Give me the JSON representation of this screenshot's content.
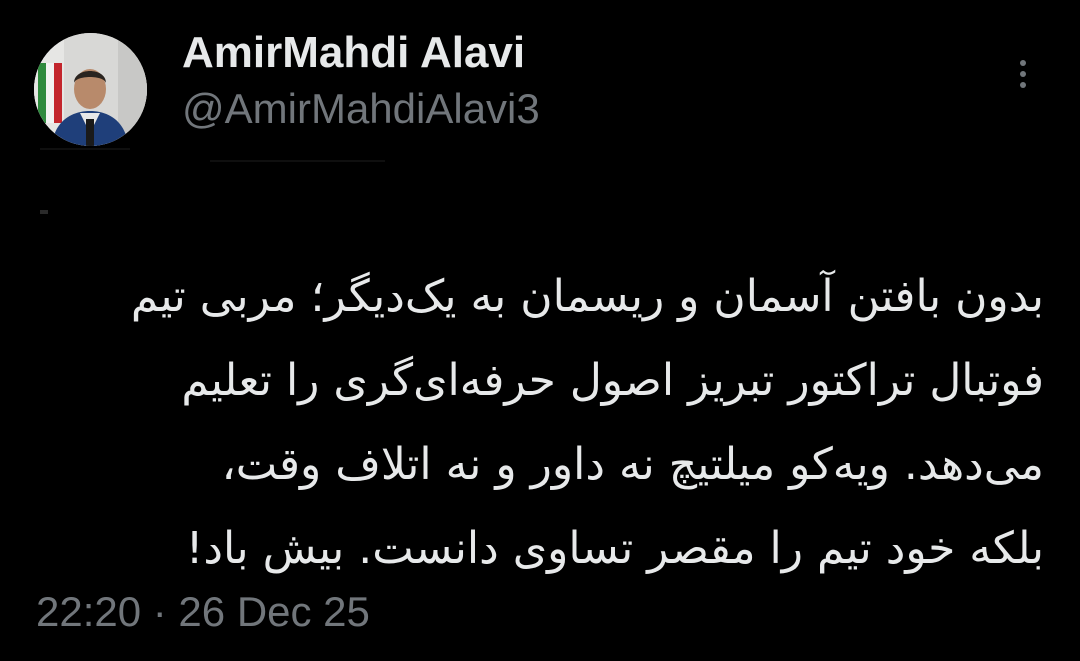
{
  "author": {
    "display_name": "AmirMahdi Alavi",
    "handle": "@AmirMahdiAlavi3",
    "avatar_icon": "profile-photo"
  },
  "tweet": {
    "lines": [
      "بدون بافتن آسمان و ریسمان به یک‌دیگر؛ مربی تیم",
      "فوتبال تراکتور تبریز اصول حرفه‌ای‌گری را تعلیم",
      "می‌دهد. ویه‌کو میلتیچ نه داور و نه اتلاف وقت،",
      "بلکه خود تیم را مقصر تساوی دانست. بیش باد!"
    ]
  },
  "meta": {
    "timestamp": "22:20 · 26 Dec 25"
  },
  "menu": {
    "icon": "more-vertical-icon"
  },
  "colors": {
    "background": "#000000",
    "primary_text": "#e7e9ea",
    "secondary_text": "#71767b"
  }
}
